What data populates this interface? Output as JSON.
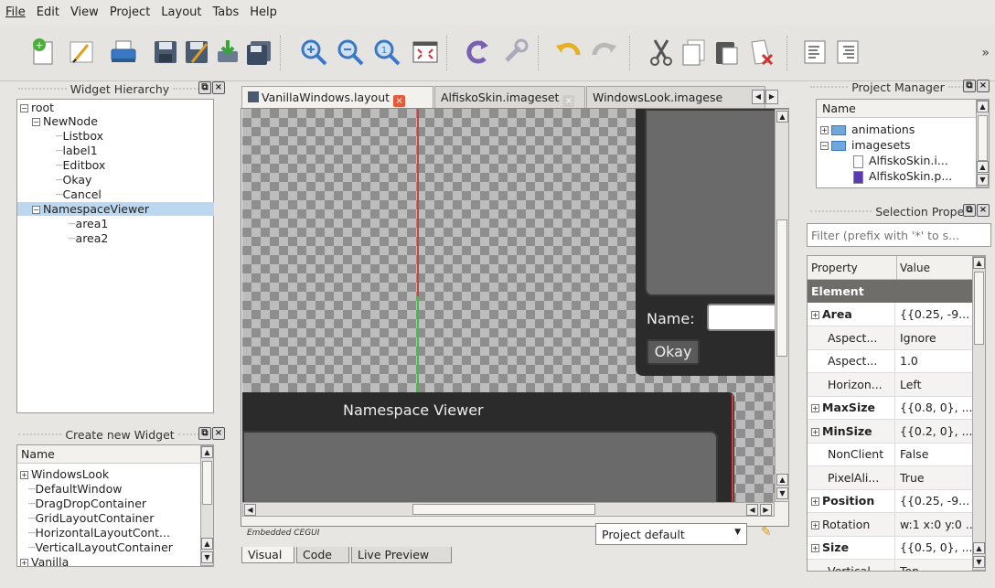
{
  "menu": [
    "File",
    "Edit",
    "View",
    "Project",
    "Layout",
    "Tabs",
    "Help"
  ],
  "toolbar": {
    "icons": [
      "new-file-icon",
      "pencil-icon",
      "print-icon",
      "save-icon",
      "save-as-icon",
      "import-icon",
      "save-all-icon",
      "zoom-in-icon",
      "zoom-out-icon",
      "zoom-reset-icon",
      "fit-view-icon",
      "reload-icon",
      "wrench-icon",
      "undo-icon",
      "redo-icon",
      "cut-icon",
      "copy-icon",
      "paste-icon",
      "delete-icon",
      "align-left-icon",
      "align-right-icon"
    ],
    "overflow": "»"
  },
  "widget_hierarchy": {
    "title": "Widget Hierarchy",
    "items": [
      {
        "label": "root",
        "expander": "-"
      },
      {
        "label": "NewNode",
        "expander": "-"
      },
      {
        "label": "Listbox",
        "expander": ""
      },
      {
        "label": "label1",
        "expander": ""
      },
      {
        "label": "Editbox",
        "expander": ""
      },
      {
        "label": "Okay",
        "expander": ""
      },
      {
        "label": "Cancel",
        "expander": ""
      },
      {
        "label": "NamespaceViewer",
        "expander": "-",
        "selected": true
      },
      {
        "label": "area1",
        "expander": ""
      },
      {
        "label": "area2",
        "expander": ""
      }
    ]
  },
  "create_widget": {
    "title": "Create new Widget",
    "column": "Name",
    "items": [
      "WindowsLook",
      "DefaultWindow",
      "DragDropContainer",
      "GridLayoutContainer",
      "HorizontalLayoutCont...",
      "VerticalLayoutContainer",
      "Vanilla"
    ]
  },
  "editor": {
    "tabs": [
      {
        "label": "VanillaWindows.layout",
        "active": true
      },
      {
        "label": "AlfiskoSkin.imageset",
        "active": false
      },
      {
        "label": "WindowsLook.imagese",
        "active": false
      }
    ],
    "canvas": {
      "name_label": "Name:",
      "okay_label": "Okay",
      "namespace_title": "Namespace Viewer"
    },
    "footer_left": "Embedded CEGUI",
    "project_select": "Project default",
    "bottom_tabs": [
      "Visual",
      "Code",
      "Live Preview"
    ]
  },
  "project_manager": {
    "title": "Project Manager",
    "column": "Name",
    "items": [
      {
        "label": "animations",
        "type": "folder"
      },
      {
        "label": "imagesets",
        "type": "folder"
      },
      {
        "label": "AlfiskoSkin.i...",
        "type": "file"
      },
      {
        "label": "AlfiskoSkin.p...",
        "type": "image"
      }
    ]
  },
  "selection_properties": {
    "title": "Selection Properties",
    "filter_placeholder": "Filter (prefix with '*' to s...",
    "col_property": "Property",
    "col_value": "Value",
    "section": "Element",
    "rows": [
      {
        "name": "Area",
        "value": "{{0.25, -9...",
        "bold": true,
        "expander": "+"
      },
      {
        "name": "Aspect...",
        "value": "Ignore",
        "bold": false,
        "expander": ""
      },
      {
        "name": "Aspect...",
        "value": "1.0",
        "bold": false,
        "expander": ""
      },
      {
        "name": "Horizon...",
        "value": "Left",
        "bold": false,
        "expander": ""
      },
      {
        "name": "MaxSize",
        "value": "{{0.8, 0}, ...",
        "bold": true,
        "expander": "+"
      },
      {
        "name": "MinSize",
        "value": "{{0.2, 0}, ...",
        "bold": true,
        "expander": "+"
      },
      {
        "name": "NonClient",
        "value": "False",
        "bold": false,
        "expander": ""
      },
      {
        "name": "PixelAli...",
        "value": "True",
        "bold": false,
        "expander": ""
      },
      {
        "name": "Position",
        "value": "{{0.25, -9...",
        "bold": true,
        "expander": "+"
      },
      {
        "name": "Rotation",
        "value": "w:1 x:0 y:0 ...",
        "bold": false,
        "expander": "+"
      },
      {
        "name": "Size",
        "value": "{{0.5, 0}, ...",
        "bold": true,
        "expander": "+"
      },
      {
        "name": "Vertical",
        "value": "Top",
        "bold": false,
        "expander": ""
      }
    ]
  }
}
